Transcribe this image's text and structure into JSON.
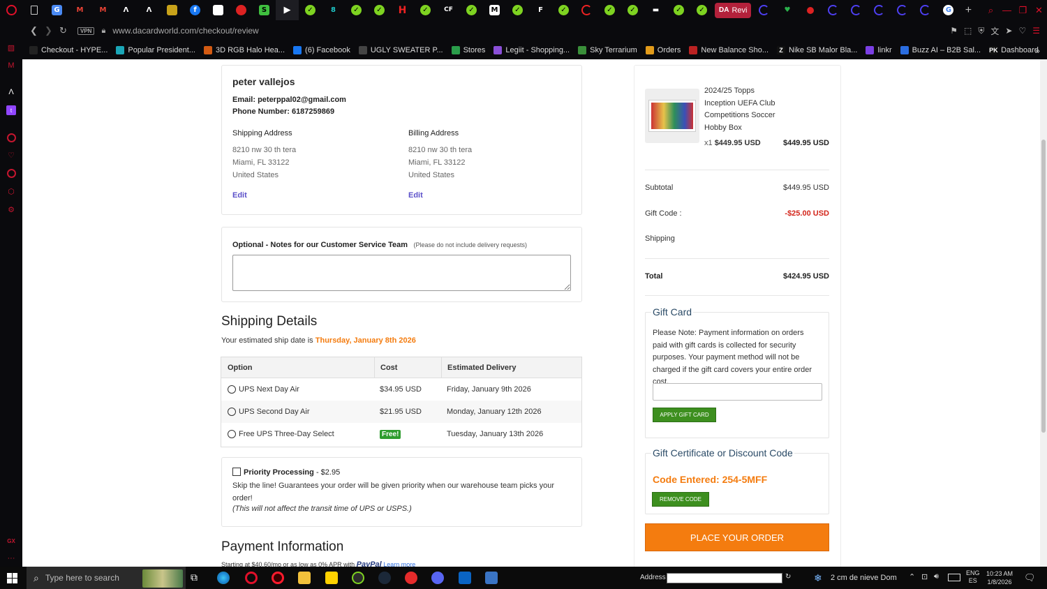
{
  "browser": {
    "active_tab_prefix": "DA",
    "active_tab_label": "Revi",
    "url": "www.dacardworld.com/checkout/review",
    "vpn_label": "VPN",
    "bookmarks": [
      {
        "label": "Checkout - HYPE...",
        "color": "#222"
      },
      {
        "label": "Popular President...",
        "color": "#1aa6b7"
      },
      {
        "label": "3D RGB Halo Hea...",
        "color": "#d35a12"
      },
      {
        "label": "(6) Facebook",
        "color": "#1877f2"
      },
      {
        "label": "UGLY SWEATER P...",
        "color": "#444"
      },
      {
        "label": "Stores",
        "color": "#2a9d4a"
      },
      {
        "label": "Legiit - Shopping...",
        "color": "#8a4fd8"
      },
      {
        "label": "Sky Terrarium",
        "color": "#3a8f3a"
      },
      {
        "label": "Orders",
        "color": "#e29b1a"
      },
      {
        "label": "New Balance Sho...",
        "color": "#b22"
      },
      {
        "label": "Nike SB Malor Bla...",
        "color": "#111",
        "glyph": "Z"
      },
      {
        "label": "linkr",
        "color": "#7b3fe4"
      },
      {
        "label": "Buzz AI – B2B Sal...",
        "color": "#2b6de0"
      },
      {
        "label": "Dashboard",
        "color": "#111",
        "glyph": "PK"
      }
    ]
  },
  "customer": {
    "name": "peter vallejos",
    "email_line": "Email: peterppal02@gmail.com",
    "phone_line": "Phone Number: 6187259869"
  },
  "shipping_address": {
    "heading": "Shipping Address",
    "line1": "8210 nw 30 th tera",
    "line2": "Miami, FL 33122",
    "line3": "United States",
    "edit_label": "Edit"
  },
  "billing_address": {
    "heading": "Billing Address",
    "line1": "8210 nw 30 th tera",
    "line2": "Miami, FL 33122",
    "line3": "United States",
    "edit_label": "Edit"
  },
  "notes": {
    "title": "Optional - Notes for our Customer Service Team",
    "hint": "(Please do not include delivery requests)",
    "value": ""
  },
  "shipping_details": {
    "title": "Shipping Details",
    "ship_date_prefix": "Your estimated ship date is",
    "ship_date": "Thursday, January 8th 2026",
    "headers": {
      "option": "Option",
      "cost": "Cost",
      "delivery": "Estimated Delivery"
    },
    "options": [
      {
        "name": "UPS Next Day Air",
        "cost": "$34.95 USD",
        "delivery": "Friday, January 9th 2026"
      },
      {
        "name": "UPS Second Day Air",
        "cost": "$21.95 USD",
        "delivery": "Monday, January 12th 2026"
      },
      {
        "name": "Free UPS Three-Day Select",
        "cost": "Free!",
        "delivery": "Tuesday, January 13th 2026"
      }
    ]
  },
  "priority": {
    "label": "Priority Processing",
    "price": "- $2.95",
    "desc": "Skip the line! Guarantees your order will be given priority when our warehouse team picks your order!",
    "note": "(This will not affect the transit time of UPS or USPS.)"
  },
  "payment": {
    "title": "Payment Information",
    "financing_text": "Starting at $40.60/mo or as low as 0% APR with",
    "paypal": "PayPal",
    "learn_more": "Learn more"
  },
  "order_item": {
    "name_l1": "2024/25 Topps",
    "name_l2": "Inception UEFA Club",
    "name_l3": "Competitions Soccer",
    "name_l4": "Hobby Box",
    "qty": "x1",
    "unit_price": "$449.95 USD",
    "line_total": "$449.95 USD"
  },
  "summary": {
    "subtotal_label": "Subtotal",
    "subtotal": "$449.95 USD",
    "gift_code_label": "Gift Code :",
    "gift_code": "-$25.00 USD",
    "shipping_label": "Shipping",
    "shipping": "",
    "total_label": "Total",
    "total": "$424.95 USD"
  },
  "gift_card": {
    "legend": "Gift Card",
    "note": "Please Note: Payment information on orders paid with gift cards is collected for security purposes. Your payment method will not be charged if the gift card covers your entire order cost.",
    "input_value": "",
    "button": "APPLY GIFT CARD"
  },
  "discount": {
    "legend": "Gift Certificate or Discount Code",
    "entered": "Code Entered: 254-5MFF",
    "button": "REMOVE CODE"
  },
  "place_order": "PLACE YOUR ORDER",
  "taskbar": {
    "search_placeholder": "Type here to search",
    "address_label": "Address",
    "weather": "2 cm de nieve Dom",
    "lang_1": "ENG",
    "lang_2": "ES",
    "time": "10:23 AM",
    "date": "1/8/2026"
  },
  "colors": {
    "accent_orange": "#f47c0f",
    "discount_red": "#d3261b",
    "button_green": "#3d8f1f",
    "link_purple": "#5b50c9",
    "browser_red": "#e0102a"
  }
}
